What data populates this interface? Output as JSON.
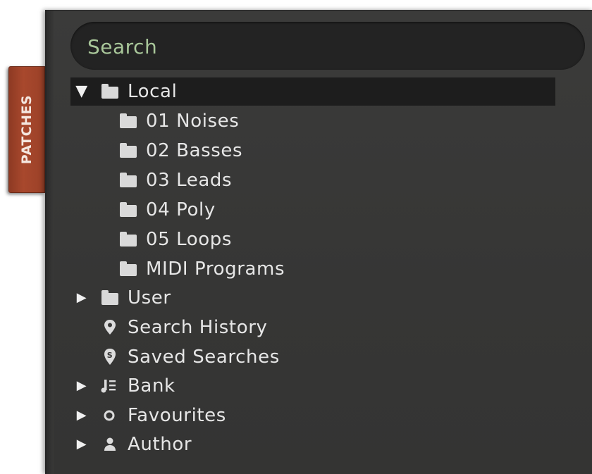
{
  "sidebar_tab": {
    "label": "PATCHES"
  },
  "search": {
    "placeholder": "Search"
  },
  "tree": {
    "local": {
      "label": "Local",
      "expanded": true,
      "icon": "folder-icon"
    },
    "local_children": [
      {
        "label": "01 Noises",
        "icon": "folder-icon"
      },
      {
        "label": "02 Basses",
        "icon": "folder-icon"
      },
      {
        "label": "03 Leads",
        "icon": "folder-icon"
      },
      {
        "label": "04 Poly",
        "icon": "folder-icon"
      },
      {
        "label": "05 Loops",
        "icon": "folder-icon"
      },
      {
        "label": "MIDI Programs",
        "icon": "folder-icon"
      }
    ],
    "user": {
      "label": "User",
      "expanded": false,
      "icon": "folder-icon"
    },
    "search_history": {
      "label": "Search History",
      "icon": "map-pin-icon"
    },
    "saved_searches": {
      "label": "Saved Searches",
      "icon": "saved-search-badge-icon"
    },
    "bank": {
      "label": "Bank",
      "expanded": false,
      "icon": "bank-icon"
    },
    "favourites": {
      "label": "Favourites",
      "expanded": false,
      "icon": "circle-icon"
    },
    "author": {
      "label": "Author",
      "expanded": false,
      "icon": "person-icon"
    }
  },
  "colors": {
    "panel": "#383837",
    "search_bg": "#232323",
    "search_text": "#a9c79a",
    "tab": "#a8482d",
    "text": "#e6e6e6",
    "selected_row": "#1d1d1d"
  }
}
